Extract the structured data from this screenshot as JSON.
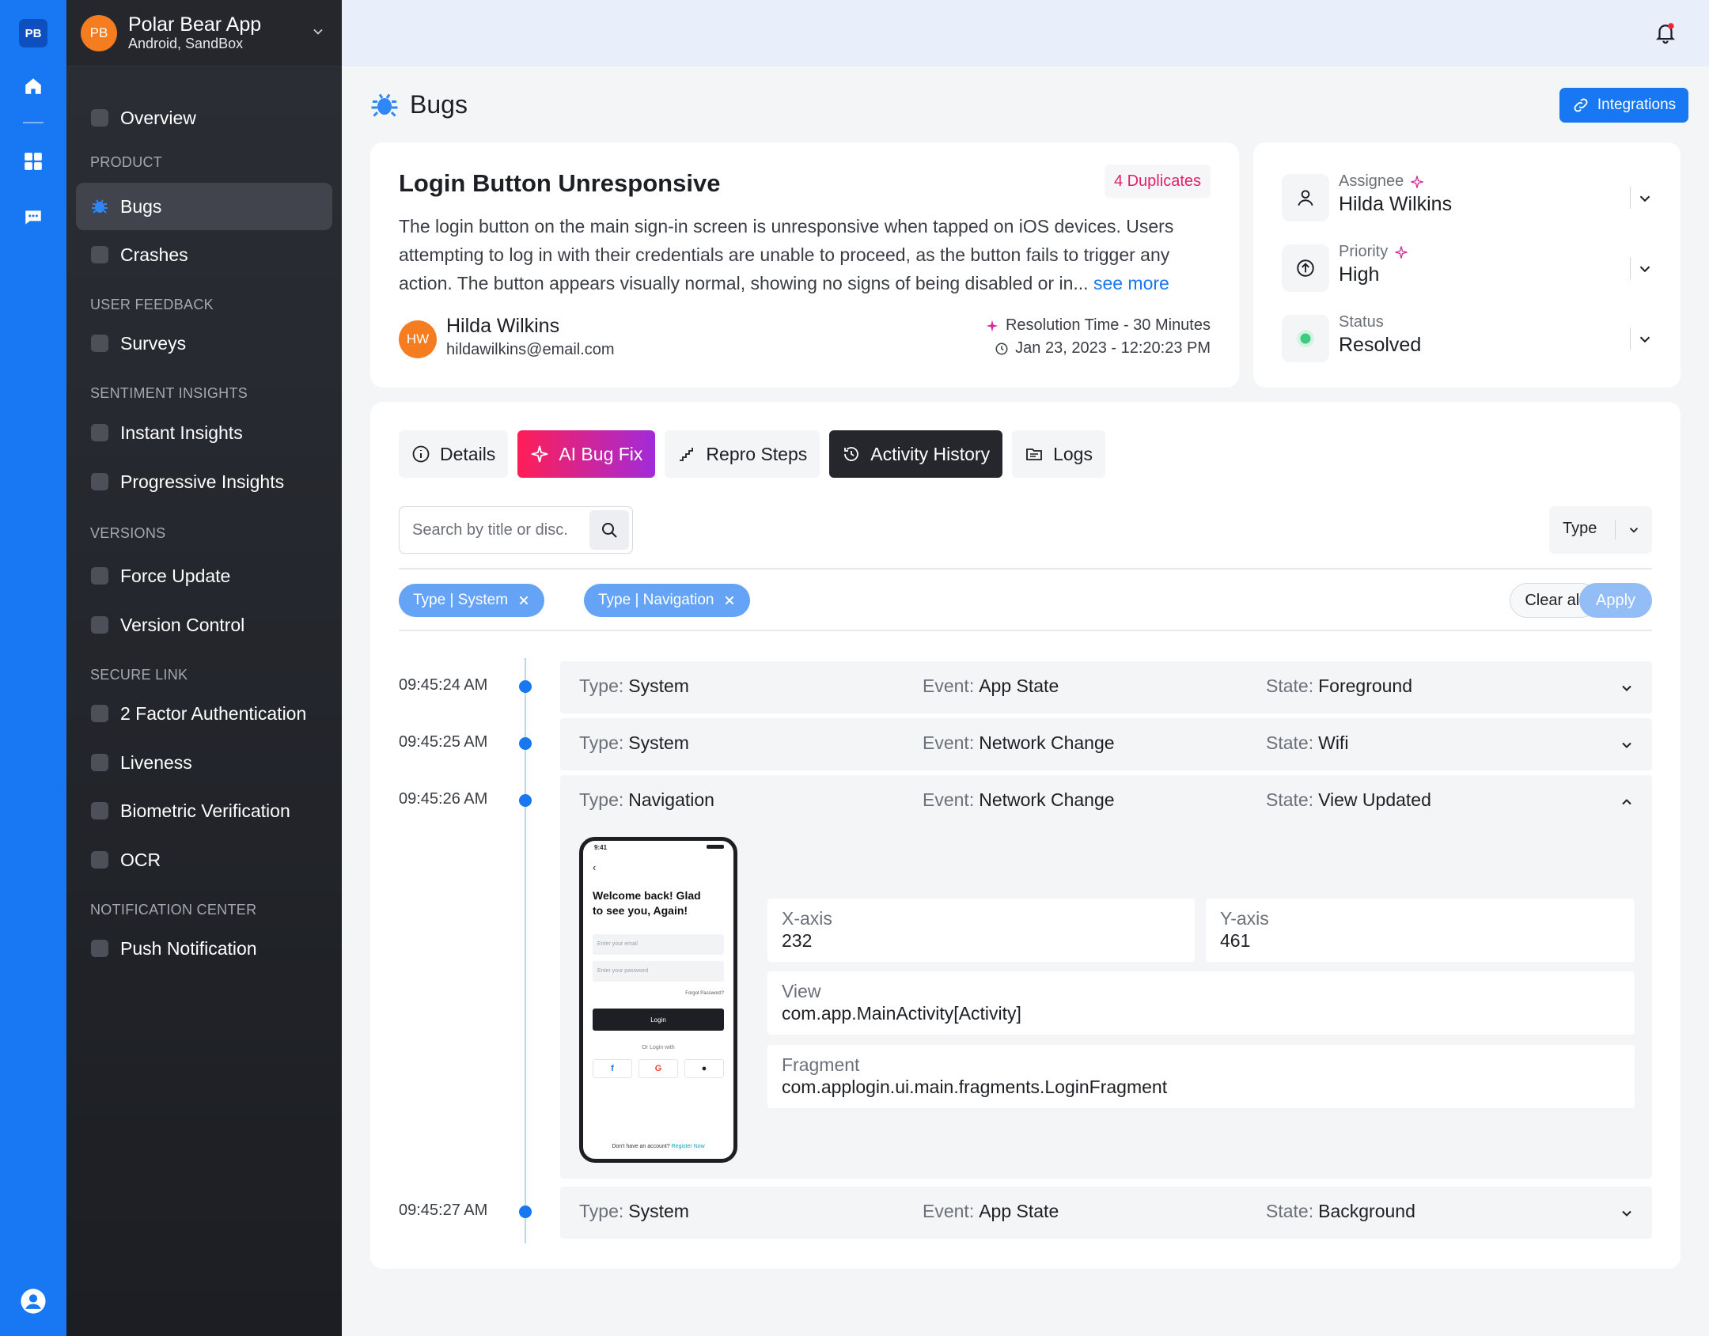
{
  "rail": {
    "logo": "PB",
    "icons": [
      "home-icon",
      "grid-icon",
      "chat-icon",
      "user-account-icon"
    ]
  },
  "app": {
    "avatar": "PB",
    "name": "Polar Bear App",
    "subtitle": "Android, SandBox"
  },
  "sidebar": {
    "overview": "Overview",
    "sections": [
      {
        "title": "PRODUCT",
        "items": [
          {
            "label": "Bugs",
            "active": true
          },
          {
            "label": "Crashes"
          }
        ]
      },
      {
        "title": "USER FEEDBACK",
        "items": [
          {
            "label": "Surveys"
          }
        ]
      },
      {
        "title": "SENTIMENT INSIGHTS",
        "items": [
          {
            "label": "Instant Insights"
          },
          {
            "label": "Progressive Insights"
          }
        ]
      },
      {
        "title": "VERSIONS",
        "items": [
          {
            "label": "Force Update"
          },
          {
            "label": "Version Control"
          }
        ]
      },
      {
        "title": "SECURE LINK",
        "items": [
          {
            "label": "2 Factor Authentication"
          },
          {
            "label": "Liveness"
          },
          {
            "label": "Biometric Verification"
          },
          {
            "label": "OCR"
          }
        ]
      },
      {
        "title": "NOTIFICATION CENTER",
        "items": [
          {
            "label": "Push Notification"
          }
        ]
      }
    ]
  },
  "page": {
    "title": "Bugs",
    "integrations_label": "Integrations"
  },
  "bug": {
    "title": "Login Button Unresponsive",
    "duplicates": "4 Duplicates",
    "description": "The login button on the main sign-in screen is unresponsive when tapped on iOS devices. Users attempting to log in with their credentials are unable to proceed, as the button fails to trigger any action. The button appears visually normal, showing no signs of being disabled or in...",
    "see_more": "see more",
    "reporter": {
      "initials": "HW",
      "name": "Hilda Wilkins",
      "email": "hildawilkins@email.com"
    },
    "resolution_time": "Resolution Time - 30 Minutes",
    "date": "Jan 23, 2023 - 12:20:23 PM"
  },
  "meta": {
    "assignee": {
      "label": "Assignee",
      "value": "Hilda Wilkins"
    },
    "priority": {
      "label": "Priority",
      "value": "High"
    },
    "status": {
      "label": "Status",
      "value": "Resolved"
    }
  },
  "tabs": [
    "Details",
    "AI Bug Fix",
    "Repro Steps",
    "Activity History",
    "Logs"
  ],
  "active_tab": "Activity History",
  "filters": {
    "search_placeholder": "Search by title or disc.",
    "type_label": "Type",
    "chips": [
      "Type | System",
      "Type | Navigation"
    ],
    "clear_all": "Clear all",
    "apply": "Apply"
  },
  "events": [
    {
      "time": "09:45:24 AM",
      "type": "System",
      "event": "App State",
      "state": "Foreground",
      "expanded": false
    },
    {
      "time": "09:45:25 AM",
      "type": "System",
      "event": "Network Change",
      "state": "Wifi",
      "expanded": false
    },
    {
      "time": "09:45:26 AM",
      "type": "Navigation",
      "event": "Network Change",
      "state": "View Updated",
      "expanded": true
    },
    {
      "time": "09:45:27 AM",
      "type": "System",
      "event": "App State",
      "state": "Background",
      "expanded": false
    }
  ],
  "field_labels": {
    "type": "Type:",
    "event": "Event:",
    "state": "State:"
  },
  "details": {
    "x_axis": {
      "label": "X-axis",
      "value": "232"
    },
    "y_axis": {
      "label": "Y-axis",
      "value": "461"
    },
    "view": {
      "label": "View",
      "value": "com.app.MainActivity[Activity]"
    },
    "fragment": {
      "label": "Fragment",
      "value": "com.applogin.ui.main.fragments.LoginFragment"
    }
  },
  "phone": {
    "time": "9:41",
    "welcome": "Welcome back! Glad to see you, Again!",
    "email_placeholder": "Enter your email",
    "password_placeholder": "Enter your password",
    "forgot": "Forgot Password?",
    "login": "Login",
    "or": "Or Login with",
    "footer": "Don't have an account?",
    "register": "Register Now"
  },
  "colors": {
    "accent": "#1877f2",
    "sidebar": "#24262c",
    "duplicates": "#e3206a",
    "ai_start": "#ff1e56",
    "ai_end": "#a12bd9",
    "status_resolved": "#3ccb7f"
  }
}
